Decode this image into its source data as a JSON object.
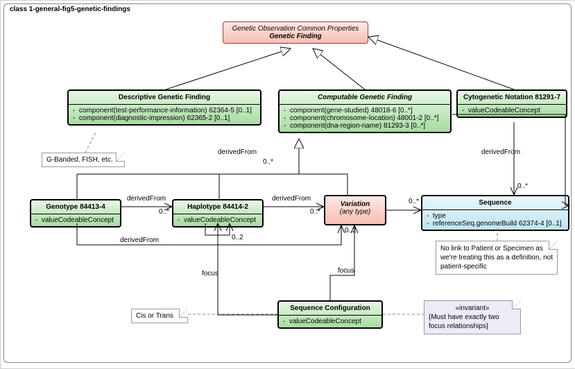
{
  "frame": {
    "title": "class 1-general-fig5-genetic-findings"
  },
  "geneticFinding": {
    "stereotype": "Genetic Observation Common Properties",
    "name": "Genetic Finding"
  },
  "descriptive": {
    "name": "Descriptive Genetic Finding",
    "rows": [
      "component(test-performance-information) 62364-5 [0..1]",
      "component(diagnostic-impression) 62365-2 [0..1]"
    ]
  },
  "computable": {
    "name": "Computable Genetic Finding",
    "rows": [
      "component(gene-studied) 48018-6 [0..*]",
      "component(chromosome-location) 48001-2 [0..*]",
      "component(dna-region-name) 81293-3 [0..*]"
    ]
  },
  "cytogenetic": {
    "name": "Cytogenetic Notation 81291-7",
    "rows": [
      "valueCodeableConcept"
    ]
  },
  "genotype": {
    "name": "Genotype  84413-4",
    "rows": [
      "valueCodeableConcept"
    ]
  },
  "haplotype": {
    "name": "Haplotype 84414-2",
    "rows": [
      "valueCodeableConcept"
    ]
  },
  "variation": {
    "name": "Variation",
    "sub": "(any type)"
  },
  "sequence": {
    "name": "Sequence",
    "rows": [
      "type",
      "referenceSeq.genomeBuild 62374-4 [0..1]"
    ]
  },
  "seqconfig": {
    "name": "Sequence Configuration",
    "rows": [
      "valueCodeableConcept"
    ]
  },
  "notes": {
    "gband": "G-Banded, FISH, etc.",
    "cistrans": "Cis or Trans",
    "seqnote": "No link to Patient or Specimen as we're treating this as a definition, not patient-specific",
    "invariant_s": "«invariant»",
    "invariant_b": "{Must have exactly two focus relationships}"
  },
  "labels": {
    "derivedFrom": "derivedFrom",
    "focus": "focus",
    "m_0s": "0..*",
    "m_02": "0..2"
  }
}
